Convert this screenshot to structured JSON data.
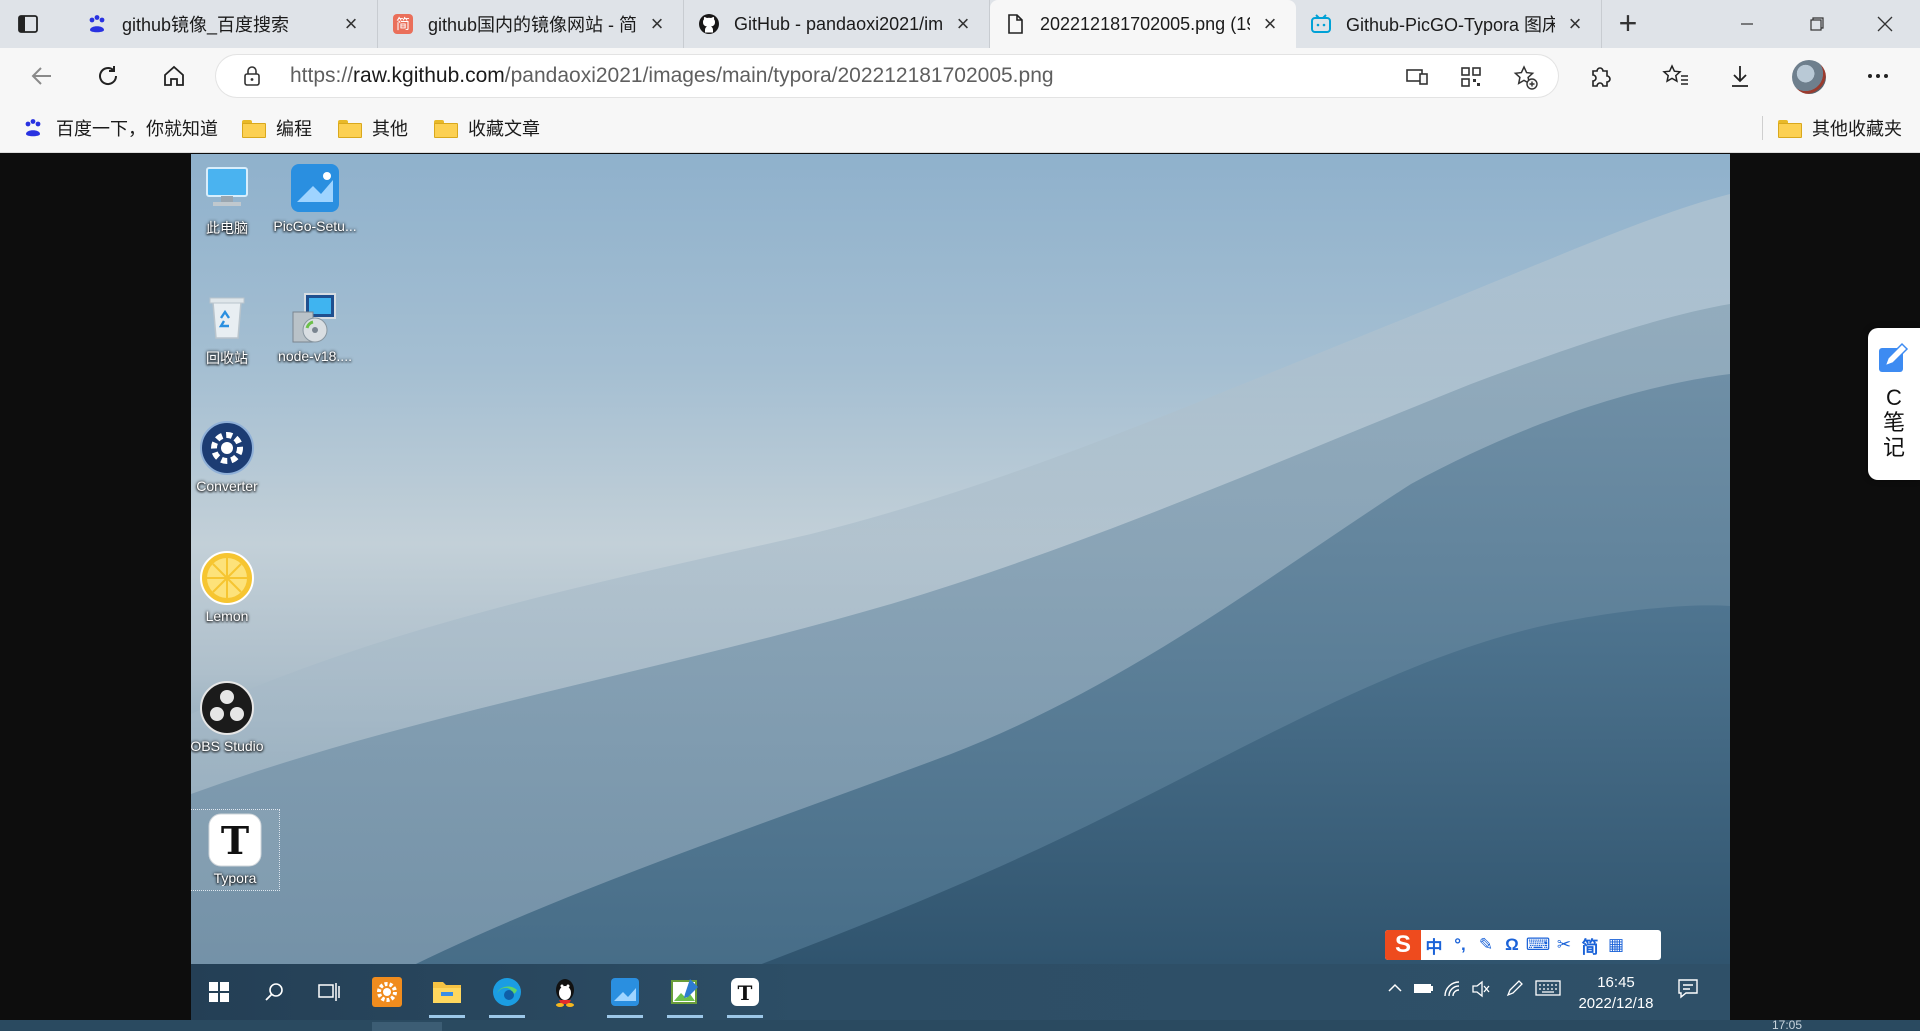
{
  "browser": {
    "tabs": [
      {
        "title": "github镜像_百度搜索",
        "icon": "baidu-paw-icon",
        "active": false
      },
      {
        "title": "github国内的镜像网站 - 简",
        "icon": "jianshu-icon",
        "active": false
      },
      {
        "title": "GitHub - pandaoxi2021/im",
        "icon": "github-icon",
        "active": false
      },
      {
        "title": "202212181702005.png (19",
        "icon": "file-icon",
        "active": true
      },
      {
        "title": "Github-PicGO-Typora 图床",
        "icon": "bilibili-icon",
        "active": false
      }
    ],
    "address": {
      "protocol": "https://",
      "domain": "raw.kgithub.com",
      "path": "/pandaoxi2021/images/main/typora/202212181702005.png"
    },
    "favorites": [
      {
        "label": "百度一下，你就知道",
        "icon": "baidu-paw-icon"
      },
      {
        "label": "编程",
        "icon": "folder-icon"
      },
      {
        "label": "其他",
        "icon": "folder-icon"
      },
      {
        "label": "收藏文章",
        "icon": "folder-icon"
      }
    ],
    "other_favorites": "其他收藏夹",
    "colors": {
      "accent": "#0067c0",
      "tabbar": "#dfe3e8",
      "toolbar": "#f7f7f7"
    }
  },
  "desktop": {
    "icons": [
      {
        "label": "此电脑",
        "icon": "this-pc-icon"
      },
      {
        "label": "PicGo-Setu...",
        "icon": "picgo-icon"
      },
      {
        "label": "回收站",
        "icon": "recycle-bin-icon"
      },
      {
        "label": "node-v18....",
        "icon": "installer-icon"
      },
      {
        "label": "Converter",
        "icon": "converter-icon"
      },
      {
        "label": "Lemon",
        "icon": "lemon-icon"
      },
      {
        "label": "OBS Studio",
        "icon": "obs-icon"
      },
      {
        "label": "Typora",
        "icon": "typora-icon"
      }
    ],
    "ime": {
      "logo": "S",
      "keys": [
        "中",
        "°,",
        "✎",
        "Ω",
        "⌨",
        "✂",
        "简",
        "▦"
      ]
    },
    "clock": {
      "time": "16:45",
      "date": "2022/12/18"
    }
  },
  "side_widget": {
    "label": "C笔记"
  },
  "bottom_time": "17:05"
}
